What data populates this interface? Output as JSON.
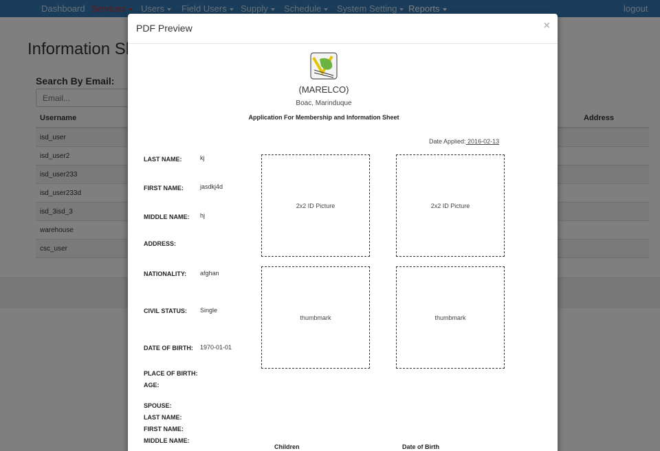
{
  "navbar": {
    "items": [
      {
        "label": "Dashboard",
        "dropdown": false
      },
      {
        "label": "Services",
        "dropdown": true
      },
      {
        "label": "Users",
        "dropdown": true
      },
      {
        "label": "Field Users",
        "dropdown": true
      },
      {
        "label": "Supply",
        "dropdown": true
      },
      {
        "label": "Schedule",
        "dropdown": true
      },
      {
        "label": "System Setting",
        "dropdown": true
      },
      {
        "label": "Reports",
        "dropdown": true
      }
    ],
    "logout": "logout",
    "colors": {
      "bar": "#337ab7",
      "active": "#c9302c"
    }
  },
  "page": {
    "title": "Information Sh",
    "search_label": "Search By Email:",
    "search_placeholder": "Email...",
    "table": {
      "headers": [
        "Username",
        "Address"
      ],
      "rows": [
        "isd_user",
        "isd_user2",
        "isd_user233",
        "isd_user233d",
        "isd_3isd_3",
        "warehouse",
        "csc_user"
      ]
    }
  },
  "modal": {
    "title": "PDF Preview",
    "close": "×",
    "org_name": "(MARELCO)",
    "org_place": "Boac, Marinduque",
    "form_title": "Application For Membership and Information Sheet",
    "date_applied_label": "Date Applied:",
    "date_applied_value": " 2016-02-13",
    "fields": {
      "last_name": {
        "label": "LAST NAME:",
        "value": "kj"
      },
      "first_name": {
        "label": "FIRST NAME:",
        "value": "jasdkj4d"
      },
      "middle_name": {
        "label": "MIDDLE NAME:",
        "value": "hj"
      },
      "address": {
        "label": "ADDRESS:",
        "value": ""
      },
      "nationality": {
        "label": "NATIONALITY:",
        "value": "afghan"
      },
      "civil_status": {
        "label": "CIVIL STATUS:",
        "value": "Single"
      },
      "date_of_birth": {
        "label": "DATE OF BIRTH:",
        "value": "1970-01-01"
      },
      "place_of_birth": {
        "label": "PLACE OF BIRTH:",
        "value": ""
      },
      "age": {
        "label": "AGE:",
        "value": ""
      },
      "spouse": {
        "label": "SPOUSE:"
      },
      "spouse_last_name": {
        "label": "LAST NAME:"
      },
      "spouse_first_name": {
        "label": "FIRST NAME:"
      },
      "spouse_middle_name": {
        "label": "MIDDLE NAME:"
      }
    },
    "photo_label": "2x2 ID Picture",
    "thumbmark_label": "thumbmark",
    "children_header": "Children",
    "dob_header": "Date of Birth"
  }
}
